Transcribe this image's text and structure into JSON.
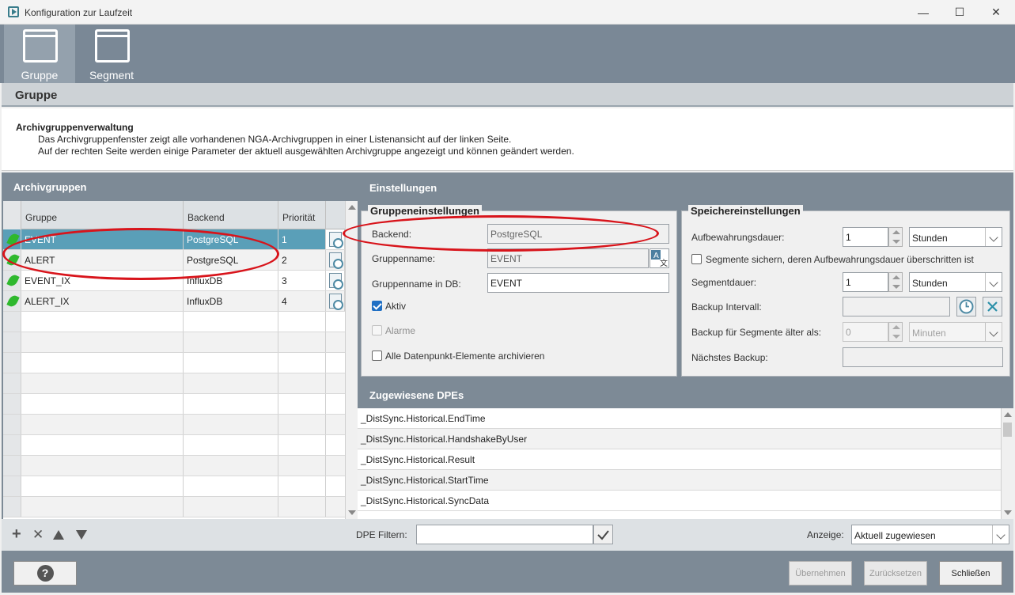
{
  "window": {
    "title": "Konfiguration zur Laufzeit",
    "minimize": "—",
    "maximize": "☐",
    "close": "✕"
  },
  "toolbar": {
    "items": [
      {
        "label": "Gruppe",
        "active": true
      },
      {
        "label": "Segment",
        "active": false
      }
    ]
  },
  "section": {
    "title": "Gruppe"
  },
  "description": {
    "heading": "Archivgruppenverwaltung",
    "line1": "Das Archivgruppenfenster zeigt alle vorhandenen NGA-Archivgruppen in einer Listenansicht auf der linken Seite.",
    "line2": "Auf der rechten Seite werden einige Parameter der aktuell ausgewählten Archivgruppe angezeigt und können geändert werden."
  },
  "archivgruppen": {
    "title": "Archivgruppen",
    "columns": [
      "Gruppe",
      "Backend",
      "Priorität"
    ],
    "rows": [
      {
        "gruppe": "EVENT",
        "backend": "PostgreSQL",
        "prioritaet": "1",
        "selected": true
      },
      {
        "gruppe": "ALERT",
        "backend": "PostgreSQL",
        "prioritaet": "2",
        "selected": false
      },
      {
        "gruppe": "EVENT_IX",
        "backend": "InfluxDB",
        "prioritaet": "3",
        "selected": false
      },
      {
        "gruppe": "ALERT_IX",
        "backend": "InfluxDB",
        "prioritaet": "4",
        "selected": false
      }
    ]
  },
  "einstellungen": {
    "title": "Einstellungen",
    "gruppeneinstellungen": {
      "legend": "Gruppeneinstellungen",
      "backend_label": "Backend:",
      "backend_value": "PostgreSQL",
      "gruppenname_label": "Gruppenname:",
      "gruppenname_value": "EVENT",
      "gruppenname_db_label": "Gruppenname in DB:",
      "gruppenname_db_value": "EVENT",
      "aktiv_label": "Aktiv",
      "aktiv_checked": true,
      "alarme_label": "Alarme",
      "alle_dpe_label": "Alle Datenpunkt-Elemente archivieren"
    },
    "speichereinstellungen": {
      "legend": "Speichereinstellungen",
      "aufbewahrung_label": "Aufbewahrungsdauer:",
      "aufbewahrung_value": "1",
      "aufbewahrung_unit": "Stunden",
      "segmente_sichern_label": "Segmente sichern, deren Aufbewahrungsdauer überschritten ist",
      "segmentdauer_label": "Segmentdauer:",
      "segmentdauer_value": "1",
      "segmentdauer_unit": "Stunden",
      "backup_intervall_label": "Backup Intervall:",
      "backup_aelter_label": "Backup für Segmente älter als:",
      "backup_aelter_value": "0",
      "backup_aelter_unit": "Minuten",
      "naechstes_backup_label": "Nächstes Backup:"
    }
  },
  "zugewiesene_dpes": {
    "title": "Zugewiesene DPEs",
    "items": [
      "_DistSync.Historical.EndTime",
      "_DistSync.Historical.HandshakeByUser",
      "_DistSync.Historical.Result",
      "_DistSync.Historical.StartTime",
      "_DistSync.Historical.SyncData"
    ]
  },
  "bottom": {
    "add": "+",
    "remove": "✕",
    "dpe_filter_label": "DPE Filtern:",
    "dpe_filter_value": "",
    "anzeige_label": "Anzeige:",
    "anzeige_value": "Aktuell zugewiesen"
  },
  "footer": {
    "help": "?",
    "uebernehmen": "Übernehmen",
    "zuruecksetzen": "Zurücksetzen",
    "schliessen": "Schließen"
  },
  "colors": {
    "toolbar": "#7a8896",
    "selection": "#5a9fb8",
    "annotation_ring": "#d8141b"
  }
}
